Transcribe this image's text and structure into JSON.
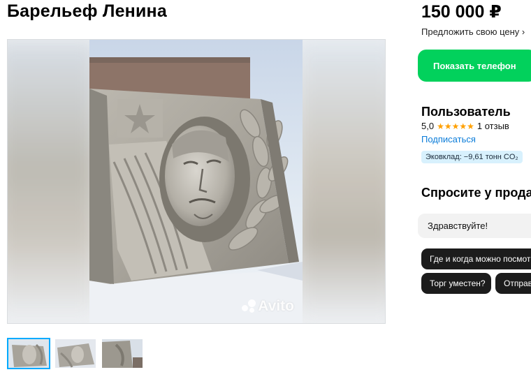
{
  "listing": {
    "title": "Барельеф Ленина",
    "price": "150 000 ₽",
    "offer_price_label": "Предложить свою цену ›",
    "show_phone_label": "Показать телефон"
  },
  "gallery": {
    "watermark": "Avito",
    "thumbnail_count": 3,
    "active_thumbnail": 1
  },
  "seller": {
    "name": "Пользователь",
    "rating": "5,0",
    "stars": "★★★★★",
    "reviews": "1 отзыв",
    "subscribe_label": "Подписаться",
    "eco_badge": "Эковклад: −9,61 тонн CO₂"
  },
  "ask": {
    "title": "Спросите у прода",
    "input_value": "Здравствуйте!",
    "chips": [
      "Где и когда можно посмотр",
      "Торг уместен?",
      "Отправ"
    ]
  },
  "colors": {
    "phone_button": "#02d15c",
    "link": "#0a7cd9",
    "active_thumbnail_border": "#00aaff",
    "star": "#ffa000",
    "chip_bg": "#1c1c1c"
  }
}
